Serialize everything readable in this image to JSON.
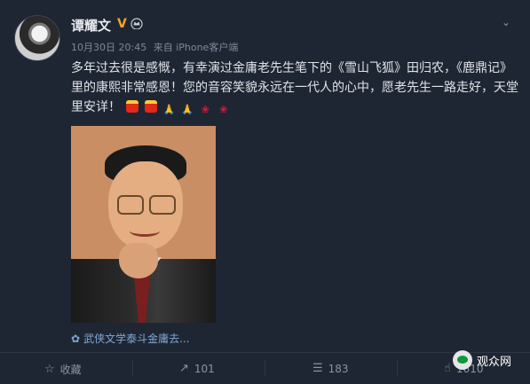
{
  "user": {
    "name": "谭耀文",
    "verified_mark": "V"
  },
  "meta": {
    "time": "10月30日 20:45",
    "source": "来自 iPhone客户端"
  },
  "post": {
    "text": "多年过去很是感慨，有幸演过金庸老先生笔下的《雪山飞狐》田归农，《鹿鼎记》里的康熙非常感恩！您的音容笑貌永远在一代人的心中，愿老先生一路走好，天堂里安详！",
    "emojis": [
      "candle",
      "candle",
      "pray",
      "pray",
      "rose",
      "rose"
    ]
  },
  "topic": {
    "label": "武侠文学泰斗金庸去..."
  },
  "actions": {
    "favorite_label": "收藏",
    "repost_count": "101",
    "comment_count": "183",
    "like_count": "1610"
  },
  "watermark": {
    "text": "观众网"
  },
  "colors": {
    "background": "#1f2633",
    "accent_link": "#7fa8d8",
    "verified": "#f5a623"
  }
}
